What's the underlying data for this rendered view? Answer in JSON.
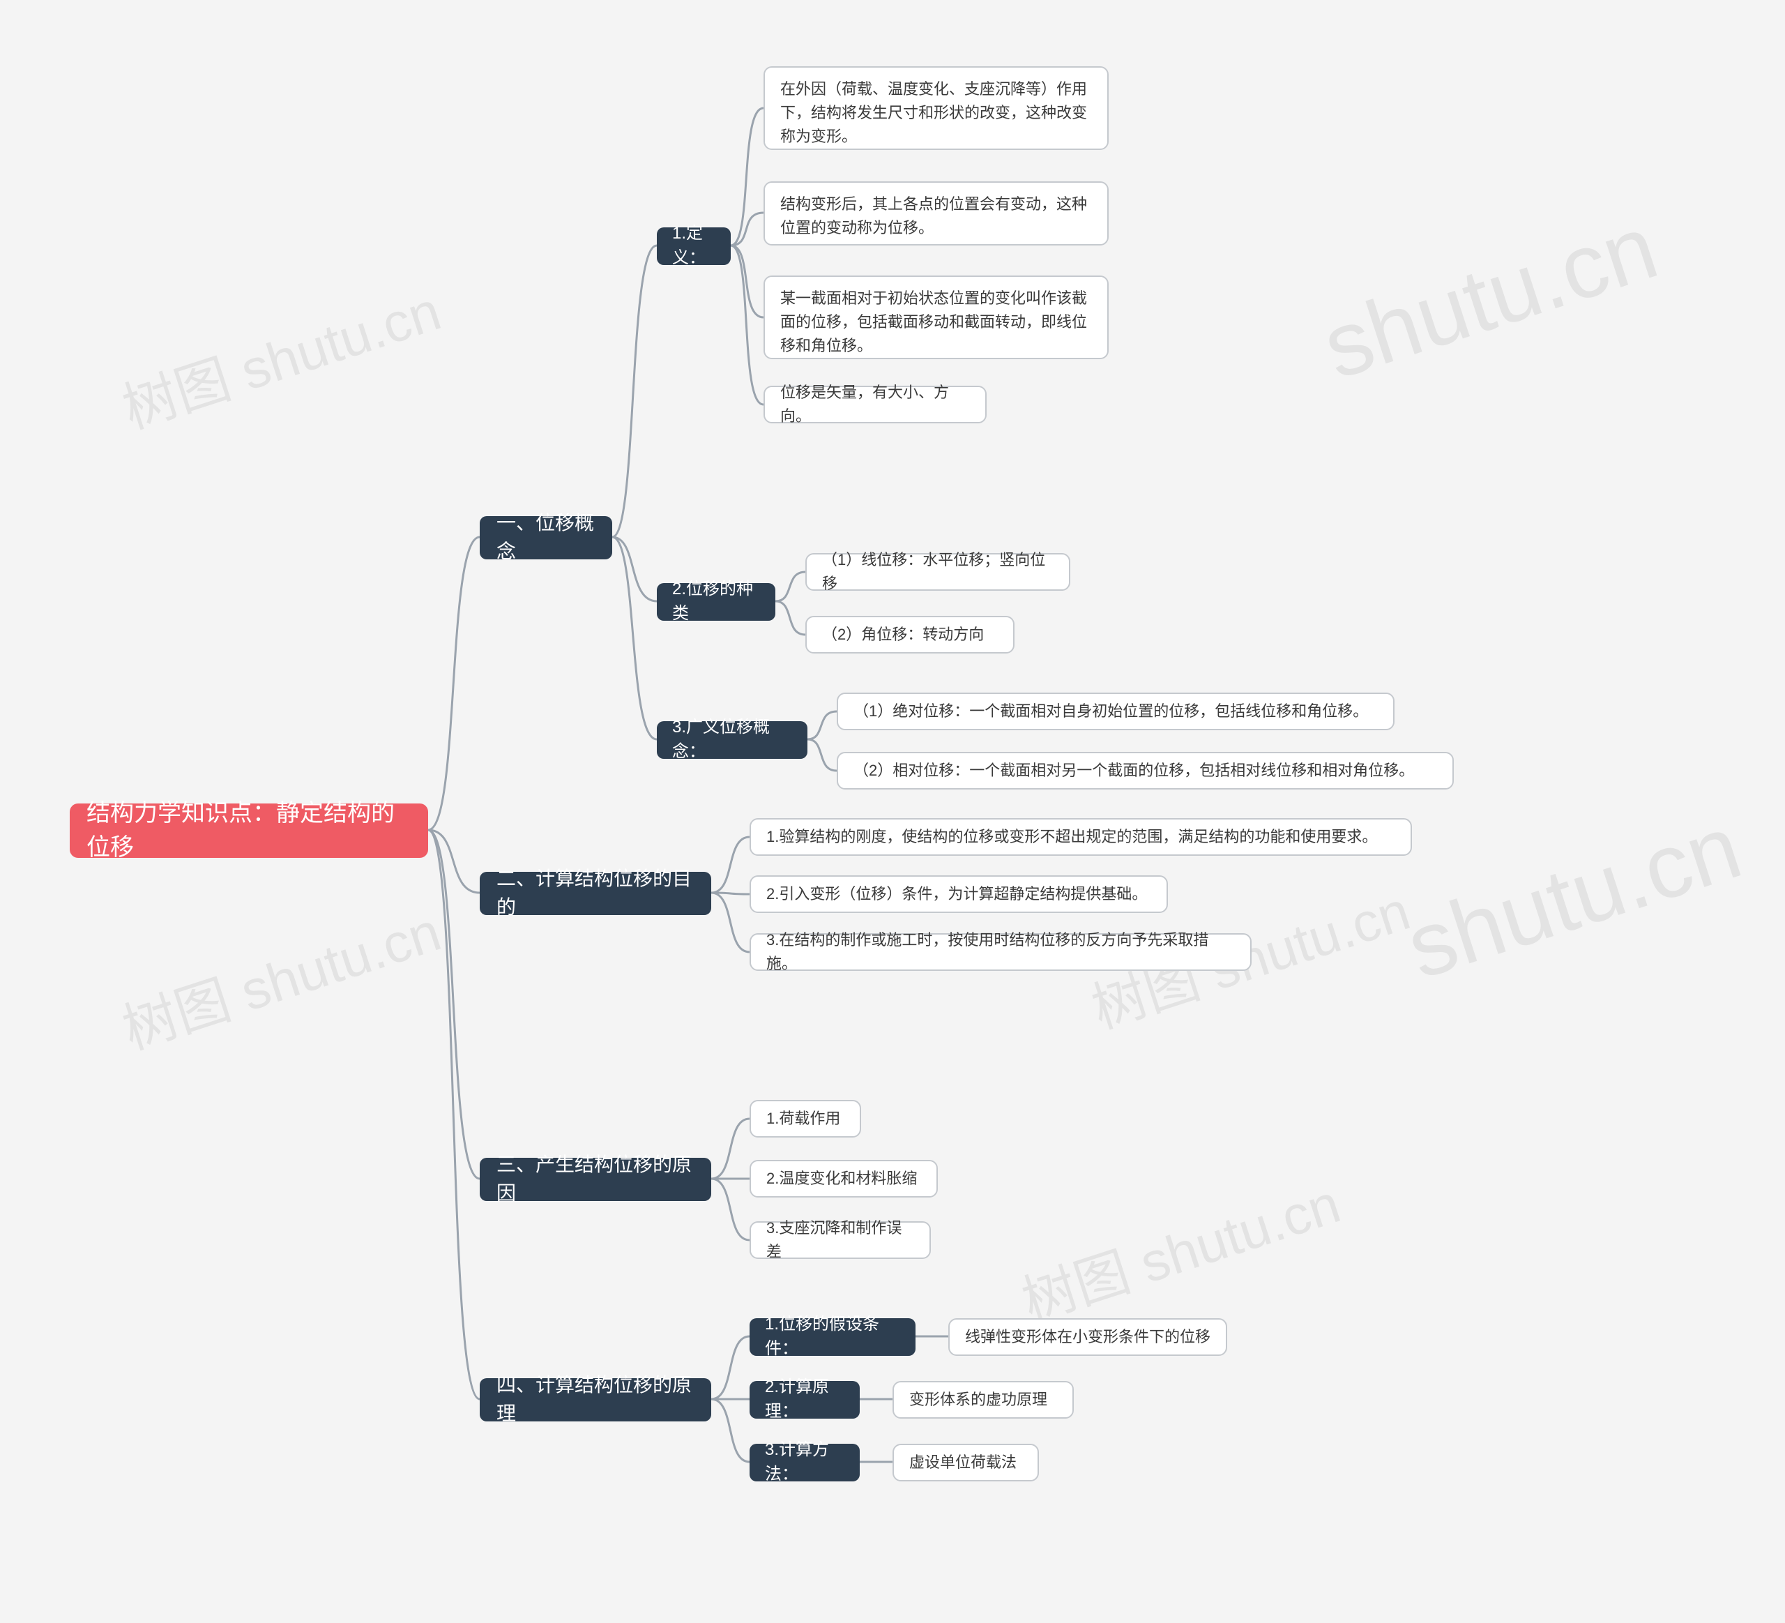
{
  "watermarks": {
    "a": "shutu.cn",
    "b": "树图 shutu.cn"
  },
  "root": "结构力学知识点：静定结构的位移",
  "branches": {
    "b1": {
      "label": "一、位移概念",
      "subs": {
        "s1": {
          "label": "1.定义：",
          "leaves": [
            "在外因（荷载、温度变化、支座沉降等）作用下，结构将发生尺寸和形状的改变，这种改变称为变形。",
            "结构变形后，其上各点的位置会有变动，这种位置的变动称为位移。",
            "某一截面相对于初始状态位置的变化叫作该截面的位移，包括截面移动和截面转动，即线位移和角位移。",
            "位移是矢量，有大小、方向。"
          ]
        },
        "s2": {
          "label": "2.位移的种类",
          "leaves": [
            "（1）线位移：水平位移；竖向位移",
            "（2）角位移：转动方向"
          ]
        },
        "s3": {
          "label": "3.广义位移概念：",
          "leaves": [
            "（1）绝对位移：一个截面相对自身初始位置的位移，包括线位移和角位移。",
            "（2）相对位移：一个截面相对另一个截面的位移，包括相对线位移和相对角位移。"
          ]
        }
      }
    },
    "b2": {
      "label": "二、计算结构位移的目的",
      "leaves": [
        "1.验算结构的刚度，使结构的位移或变形不超出规定的范围，满足结构的功能和使用要求。",
        "2.引入变形（位移）条件，为计算超静定结构提供基础。",
        "3.在结构的制作或施工时，按使用时结构位移的反方向予先采取措施。"
      ]
    },
    "b3": {
      "label": "三、产生结构位移的原因",
      "leaves": [
        "1.荷载作用",
        "2.温度变化和材料胀缩",
        "3.支座沉降和制作误差"
      ]
    },
    "b4": {
      "label": "四、计算结构位移的原理",
      "subs": {
        "s1": {
          "label": "1.位移的假设条件：",
          "leaf": "线弹性变形体在小变形条件下的位移"
        },
        "s2": {
          "label": "2.计算原理：",
          "leaf": "变形体系的虚功原理"
        },
        "s3": {
          "label": "3.计算方法：",
          "leaf": "虚设单位荷载法"
        }
      }
    }
  }
}
